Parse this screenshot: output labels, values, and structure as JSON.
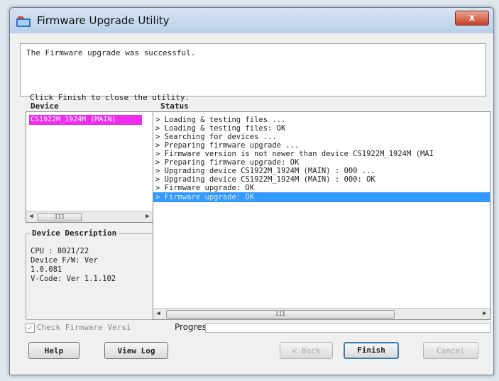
{
  "window": {
    "title": "Firmware Upgrade Utility",
    "close_glyph": "x"
  },
  "message": {
    "result": "The Firmware upgrade was successful.",
    "instruction": "Click Finish to close the utility."
  },
  "device_panel": {
    "header": "Device",
    "items": [
      "CS1922M_1924M (MAIN)"
    ],
    "scroll_thumb": "III"
  },
  "device_description": {
    "legend": "Device Description",
    "lines": [
      "CPU : 8021/22",
      "Device F/W: Ver",
      "1.0.081",
      "V-Code: Ver 1.1.102"
    ]
  },
  "status_panel": {
    "header": "Status",
    "lines": [
      "> Loading & testing files ...",
      "> Loading & testing files: OK",
      "> Searching for devices ...",
      "> Preparing firmware upgrade ...",
      "> Firmware version is not newer than device CS1922M_1924M (MAI",
      "> Preparing firmware upgrade: OK",
      "> Upgrading device CS1922M_1924M (MAIN) : 000 ...",
      "> Upgrading device CS1922M_1924M (MAIN) : 000: OK",
      "> Firmware upgrade: OK",
      "> Firmware upgrade: OK"
    ],
    "selected_index": 9,
    "scroll_thumb": "III"
  },
  "check_firmware": {
    "label": "Check Firmware Versi",
    "checked": true
  },
  "progress": {
    "label": "Progress.",
    "value": 0
  },
  "buttons": {
    "help": "Help",
    "view_log": "View Log",
    "back": "< Back",
    "finish": "Finish",
    "cancel": "Cancel"
  },
  "colors": {
    "selected_device": "#ee2cee",
    "selected_status": "#3399ff",
    "titlebar": "#c4d8ee"
  }
}
